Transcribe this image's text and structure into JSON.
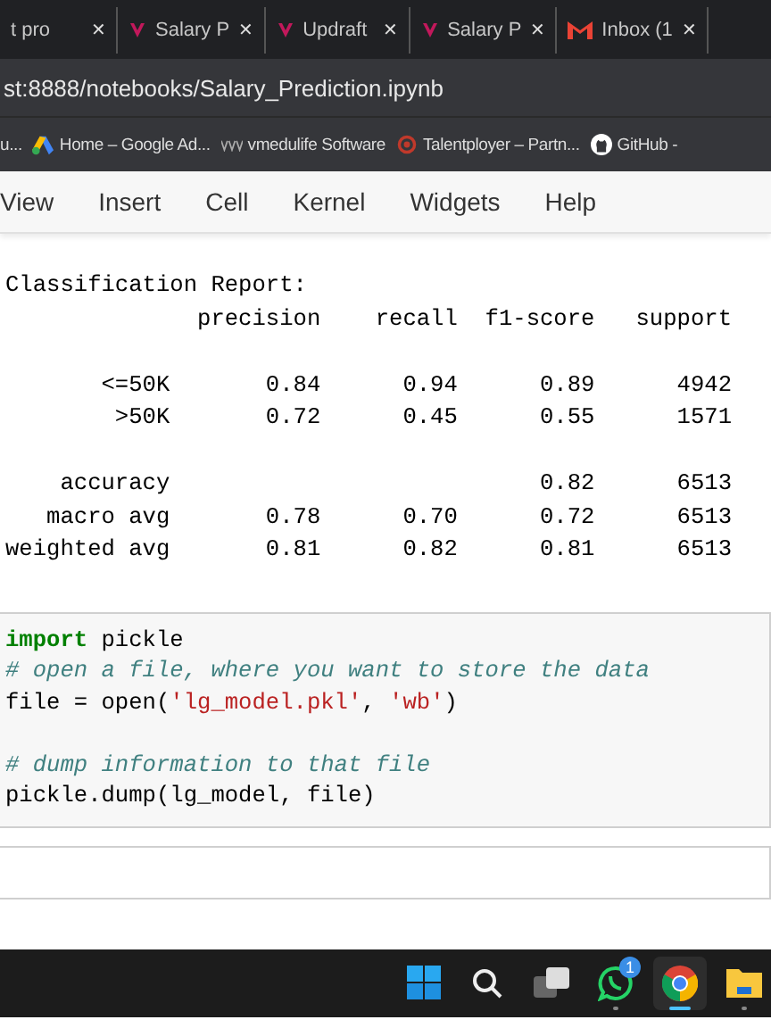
{
  "browser_tabs": [
    {
      "title": "t pro",
      "kind": "plain",
      "close": "✕",
      "selected": false
    },
    {
      "title": "Salary P",
      "kind": "v",
      "close": "✕",
      "selected": false
    },
    {
      "title": "Updraft",
      "kind": "v",
      "close": "✕",
      "selected": false
    },
    {
      "title": "Salary P",
      "kind": "v",
      "close": "✕",
      "selected": false
    },
    {
      "title": "Inbox (1",
      "kind": "mail",
      "close": "✕",
      "selected": false
    }
  ],
  "address_bar": {
    "url": "st:8888/notebooks/Salary_Prediction.ipynb"
  },
  "bookmarks": [
    {
      "label": "u...",
      "kind": "plain"
    },
    {
      "label": "Home – Google Ad...",
      "kind": "ads"
    },
    {
      "label": "vmedulife Software",
      "kind": "waves"
    },
    {
      "label": "Talentployer – Partn...",
      "kind": "target"
    },
    {
      "label": "GitHub -",
      "kind": "github"
    }
  ],
  "menu": [
    "View",
    "Insert",
    "Cell",
    "Kernel",
    "Widgets",
    "Help"
  ],
  "output": {
    "title": "Classification Report:",
    "header": "              precision    recall  f1-score   support",
    "class_rows": [
      "       <=50K       0.84      0.94      0.89      4942",
      "        >50K       0.72      0.45      0.55      1571"
    ],
    "summary_rows": [
      "    accuracy                           0.82      6513",
      "   macro avg       0.78      0.70      0.72      6513",
      "weighted avg       0.81      0.82      0.81      6513"
    ]
  },
  "code_cell": {
    "blocks": [
      [
        [
          {
            "kind": "keyword",
            "text": "import"
          },
          {
            "kind": "plain",
            "text": " pickle"
          }
        ],
        [
          {
            "kind": "comment",
            "text": "# open a file, where you want to store the data"
          }
        ],
        [
          {
            "kind": "plain",
            "text": "file = open("
          },
          {
            "kind": "string",
            "text": "'lg_model.pkl'"
          },
          {
            "kind": "plain",
            "text": ", "
          },
          {
            "kind": "string",
            "text": "'wb'"
          },
          {
            "kind": "plain",
            "text": ")"
          }
        ]
      ],
      [
        [
          {
            "kind": "comment",
            "text": "# dump information to that file"
          }
        ],
        [
          {
            "kind": "plain",
            "text": "pickle.dump(lg_model, file)"
          }
        ]
      ]
    ]
  },
  "taskbar": [
    {
      "kind": "start",
      "selected": false
    },
    {
      "kind": "search",
      "selected": false
    },
    {
      "kind": "taskview",
      "selected": false
    },
    {
      "kind": "whatsapp",
      "selected": false,
      "badge": "1"
    },
    {
      "kind": "chrome",
      "selected": true
    },
    {
      "kind": "explorer",
      "selected": false
    }
  ]
}
